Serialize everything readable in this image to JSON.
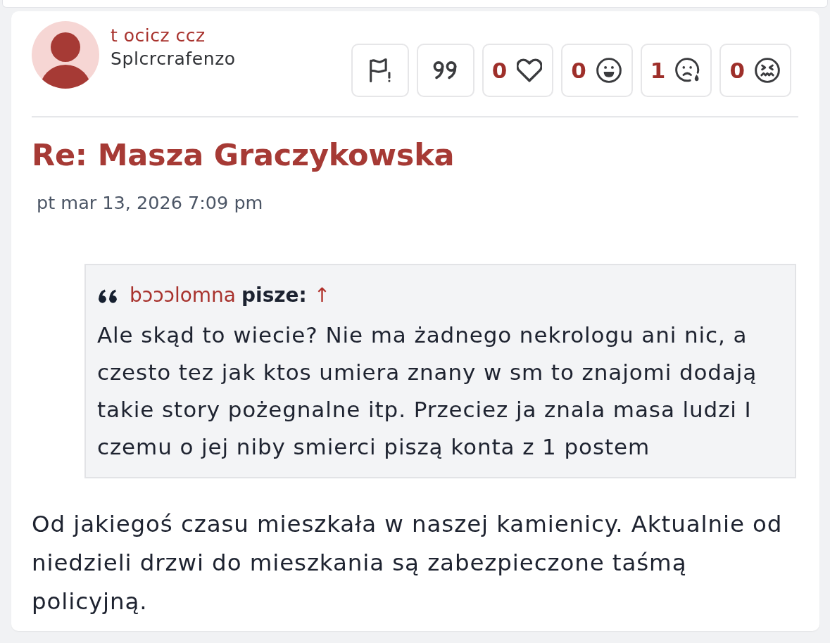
{
  "post": {
    "author": {
      "username": "t ocicz ccz",
      "rank": "Splcrcrafenzo"
    },
    "actions": [
      {
        "kind": "report"
      },
      {
        "kind": "quote"
      }
    ],
    "reactions": [
      {
        "kind": "heart",
        "count": "0"
      },
      {
        "kind": "grin",
        "count": "0"
      },
      {
        "kind": "cry",
        "count": "1"
      },
      {
        "kind": "sick",
        "count": "0"
      }
    ],
    "title": "Re: Masza Graczykowska",
    "date": "pt mar 13, 2026 7:09 pm",
    "quote": {
      "author": "bɔɔɔlomna",
      "verb": "pisze:",
      "jump_link": "↑",
      "text": "Ale skąd to wiecie? Nie ma żadnego nekrologu ani nic, a czesto tez jak ktos umiera znany w sm to znajomi dodają takie story pożegnalne itp. Przeciez ja znala masa ludzi I czemu o jej niby smierci piszą konta z 1 postem"
    },
    "body": "Od jakiegoś czasu mieszkała w naszej kamienicy. Aktualnie od niedzieli drzwi do mieszkania są zabezpieczone taśmą policyjną."
  }
}
